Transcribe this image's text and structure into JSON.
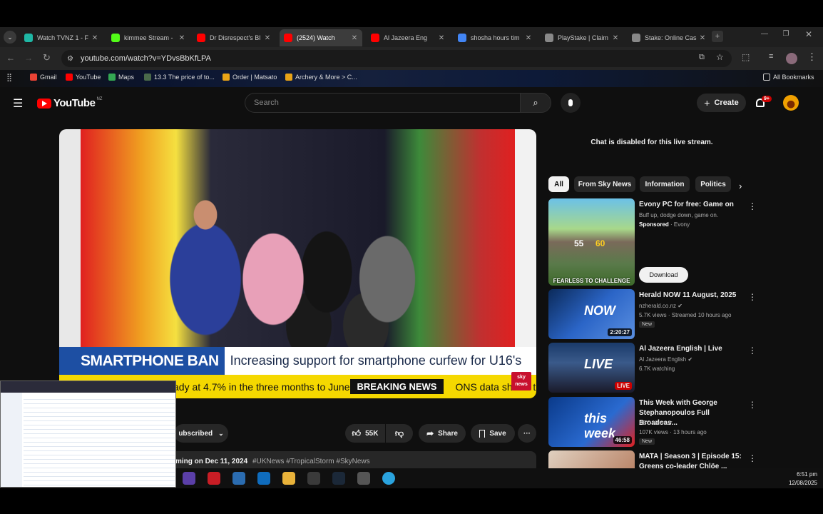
{
  "browser": {
    "tabs": [
      {
        "label": "Watch TVNZ 1 - F",
        "color": "#1fb7a5"
      },
      {
        "label": "kimmee Stream -",
        "color": "#53fc18"
      },
      {
        "label": "Dr Disrespect's Bl",
        "color": "#ff0000"
      },
      {
        "label": "(2524) Watch",
        "color": "#ff0000",
        "active": true
      },
      {
        "label": "Al Jazeera Eng",
        "color": "#ff0000"
      },
      {
        "label": "shosha hours tim",
        "color": "#4285f4"
      },
      {
        "label": "PlayStake | Claim",
        "color": "#888888"
      },
      {
        "label": "Stake: Online Cas",
        "color": "#888888"
      }
    ],
    "new_tab_label": "+",
    "url": "youtube.com/watch?v=YDvsBbKfLPA",
    "bookmarks": [
      {
        "label": "Gmail",
        "color": "#ea4335"
      },
      {
        "label": "YouTube",
        "color": "#ff0000"
      },
      {
        "label": "Maps",
        "color": "#34a853"
      },
      {
        "label": "13.3 The price of to...",
        "color": "#4a6a4a"
      },
      {
        "label": "Order | Matsato",
        "color": "#e8a317"
      },
      {
        "label": "Archery & More > C...",
        "color": "#e8a317"
      }
    ],
    "all_bookmarks": "All Bookmarks"
  },
  "youtube": {
    "logo_text": "YouTube",
    "region": "NZ",
    "search_placeholder": "Search",
    "create_label": "Create",
    "notif_count": "9+",
    "chat_disabled": "Chat is disabled for this live stream.",
    "chips": [
      "All",
      "From Sky News",
      "Information",
      "Politics"
    ],
    "ticker": {
      "tag": "SMARTPHONE BAN",
      "headline": "Increasing support for smartphone curfew for U16's",
      "scroll_text": "ady at 4.7% in the three months to June",
      "breaking": "BREAKING NEWS",
      "scroll_text2": "ONS data shows the",
      "brand": "sky news"
    },
    "actions": {
      "subscribed": "ubscribed",
      "likes": "55K",
      "share": "Share",
      "save": "Save",
      "more": "···"
    },
    "description_text": "ming on Dec 11, 2024",
    "hashtags": "#UKNews #TropicalStorm #SkyNews",
    "ad": {
      "title": "Evony PC for free: Game on",
      "subtitle": "Buff up, dodge down, game on.",
      "sponsored": "Sponsored",
      "advertiser": "Evony",
      "cta": "Download",
      "thumb_caption": "FEARLESS TO CHALLENGE",
      "thumb_n1": "55",
      "thumb_n2": "60"
    },
    "videos": [
      {
        "title": "Herald NOW 11 August, 2025",
        "channel": "nzherald.co.nz",
        "meta": "5.7K views · Streamed 10 hours ago",
        "badge": "New",
        "duration": "2:20:27",
        "thumb_text": "NOW"
      },
      {
        "title": "Al Jazeera English | Live",
        "channel": "Al Jazeera English",
        "meta": "6.7K watching",
        "badge": "",
        "duration": "LIVE",
        "thumb_text": "LIVE"
      },
      {
        "title": "This Week with George Stephanopoulos Full Broadcas...",
        "channel": "ABC News",
        "meta": "107K views · 13 hours ago",
        "badge": "New",
        "duration": "46:58",
        "thumb_text": "this week"
      },
      {
        "title": "MATA | Season 3 | Episode 15: Greens co-leader Chlöe ...",
        "channel": "",
        "meta": "",
        "badge": "",
        "duration": "",
        "thumb_text": ""
      }
    ]
  },
  "taskbar": {
    "time": "6:51 pm",
    "date": "12/08/2025"
  }
}
